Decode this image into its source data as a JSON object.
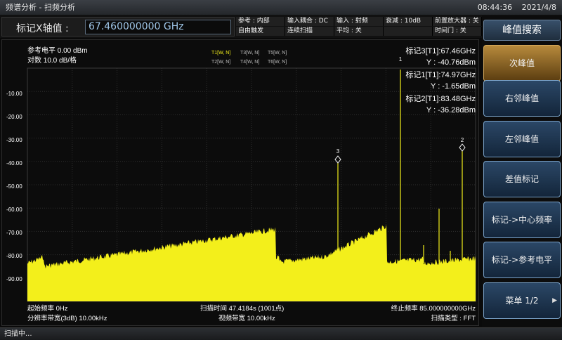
{
  "titlebar": {
    "title": "频谱分析 - 扫频分析",
    "time": "08:44:36",
    "date": "2021/4/8"
  },
  "marker_x": {
    "label": "标记X轴值 :",
    "value": "67.460000000 GHz"
  },
  "params": [
    {
      "text": "参考 : 内部"
    },
    {
      "text": "输入耦合 : DC"
    },
    {
      "text": "输入 : 射频"
    },
    {
      "text": "衰减 : 10dB"
    },
    {
      "text": "前置放大器 : 关"
    },
    {
      "text": "自由触发"
    },
    {
      "text": "连续扫描"
    },
    {
      "text": "平均 : 关"
    },
    {
      "text": ""
    },
    {
      "text": "时间门 : 关"
    }
  ],
  "plot": {
    "ref_level": "参考电平 0.00 dBm",
    "scale": "对数 10.0 dB/格",
    "traces_row1": [
      "T1[W, N]",
      "T3[W, N]",
      "T5[W, N]"
    ],
    "traces_row2": [
      "T2[W, N]",
      "T4[W, N]",
      "T6[W, N]"
    ],
    "y_ticks": [
      "-10.00",
      "-20.00",
      "-30.00",
      "-40.00",
      "-50.00",
      "-60.00",
      "-70.00",
      "-80.00",
      "-90.00"
    ],
    "markers": [
      {
        "name": "标记3[T1]:67.46GHz",
        "y": "Y : -40.76dBm"
      },
      {
        "name": "标记1[T1]:74.97GHz",
        "y": "Y : -1.65dBm"
      },
      {
        "name": "标记2[T1]:83.48GHz",
        "y": "Y : -36.28dBm"
      }
    ],
    "marker_tags": [
      "3",
      "2",
      "1"
    ],
    "start_freq": "起始频率 0Hz",
    "sweep_time": "扫描时间 47.4184s (1001点)",
    "stop_freq": "终止频率 85.000000000GHz",
    "rbw": "分辨率带宽(3dB) 10.00kHz",
    "vbw": "视频带宽 10.00kHz",
    "sweep_type": "扫描类型 : FFT",
    "colors": {
      "trace": "#f3ef1b",
      "grid": "#2e2e2e",
      "text": "#ffffff",
      "trace_label_active": "#f3ef1b",
      "trace_label": "#bdbdbd"
    }
  },
  "softkeys": {
    "title": "峰值搜索",
    "items": [
      {
        "label": "次峰值",
        "active": true
      },
      {
        "label": "右邻峰值"
      },
      {
        "label": "左邻峰值"
      },
      {
        "label": "差值标记"
      },
      {
        "label": "标记->中心频率"
      },
      {
        "label": "标记->参考电平"
      },
      {
        "label": "菜单 1/2",
        "arrow": "▶"
      }
    ]
  },
  "status": "扫描中..."
}
